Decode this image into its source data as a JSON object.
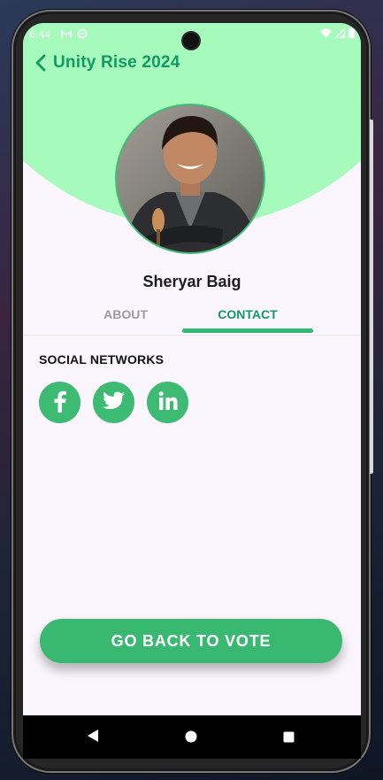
{
  "status_bar": {
    "time": "6:44",
    "left_icons": [
      "gmail-icon",
      "sync-icon"
    ],
    "right_icons": [
      "wifi-icon",
      "signal-icon",
      "battery-icon"
    ]
  },
  "app_bar": {
    "back_icon": "chevron-left-icon",
    "title": "Unity Rise 2024"
  },
  "profile": {
    "avatar_alt": "Candidate photo",
    "name": "Sheryar Baig"
  },
  "tabs": [
    {
      "label": "ABOUT",
      "selected": false
    },
    {
      "label": "CONTACT",
      "selected": true
    }
  ],
  "contact": {
    "section_title": "SOCIAL NETWORKS",
    "social_links": [
      {
        "icon": "facebook-icon"
      },
      {
        "icon": "twitter-icon"
      },
      {
        "icon": "linkedin-icon"
      }
    ]
  },
  "vote_button": {
    "label": "GO BACK TO VOTE"
  },
  "nav_bar": {
    "items": [
      "back-triangle-icon",
      "home-circle-icon",
      "recents-square-icon"
    ]
  },
  "colors": {
    "accent": "#129a63",
    "header_bg": "#a6fbbc",
    "button": "#39b872",
    "screen_bg": "#fbf6fd"
  }
}
